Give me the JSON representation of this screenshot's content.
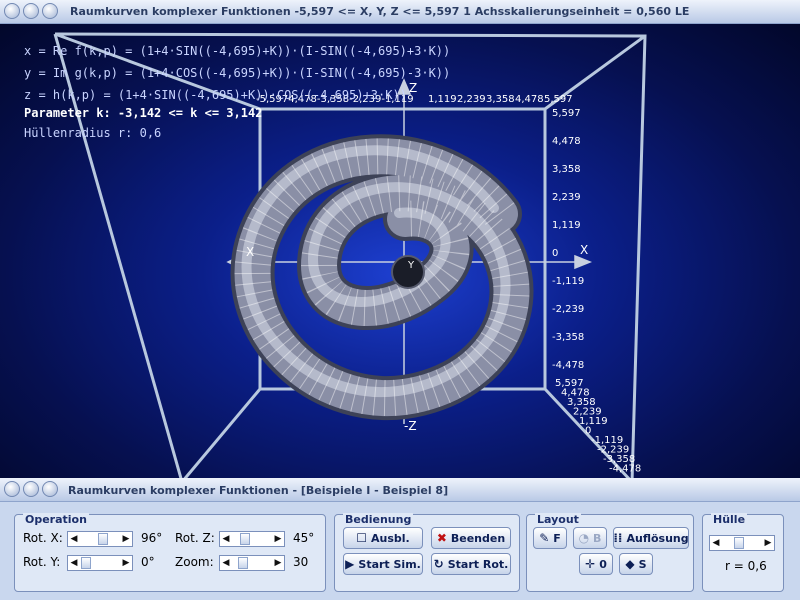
{
  "window_top": {
    "title": "Raumkurven komplexer Funktionen   -5,597 <= X, Y, Z <= 5,597    1 Achsskalierungseinheit = 0,560 LE"
  },
  "window_bottom": {
    "title": "Raumkurven komplexer Funktionen - [Beispiele I - Beispiel 8]"
  },
  "formulas": {
    "x": "x = Re f(k,p) = (1+4·SIN((-4,695)+K))·(I-SIN((-4,695)+3·K))",
    "y": "y = Im g(k,p) = (1+4·COS((-4,695)+K))·(I-SIN((-4,695)-3·K))",
    "z": "z = h(k,p) = (1+4·SIN((-4,695)+K))·COS((-4,695)+3·K))",
    "param": "Parameter k: -3,142 <= k <= 3,142",
    "radius": "Hüllenradius r: 0,6"
  },
  "axes": {
    "x_name": "X",
    "x_neg_name": "X",
    "z_name": "Z",
    "z_neg_name": "-Z",
    "y_name": "Y",
    "top_left_ticks": "-5,5974,478-3,358-2,239-1,119",
    "top_right_ticks": [
      "1,119",
      "2,239",
      "3,358",
      "4,478",
      "5,597"
    ],
    "right_ticks": [
      "5,597",
      "4,478",
      "3,358",
      "2,239",
      "1,119",
      "0",
      "-1,119",
      "-2,239",
      "-3,358",
      "-4,478"
    ],
    "diag_ticks": [
      "5,597",
      "4,478",
      "3,358",
      "2,239",
      "1,119",
      "0",
      "-1,119",
      "-2,239",
      "-3,358",
      "-4,478"
    ]
  },
  "operation": {
    "title": "Operation",
    "rot_x_label": "Rot. X:",
    "rot_x_value": "96°",
    "rot_y_label": "Rot. Y:",
    "rot_y_value": "0°",
    "rot_z_label": "Rot. Z:",
    "rot_z_value": "45°",
    "zoom_label": "Zoom:",
    "zoom_value": "30"
  },
  "bedienung": {
    "title": "Bedienung",
    "ausbl": "Ausbl.",
    "beenden": "Beenden",
    "start_sim": "Start Sim.",
    "start_rot": "Start Rot."
  },
  "layout": {
    "title": "Layout",
    "f": "F",
    "b": "B",
    "aufloesung": "Auflösung",
    "zero": "0",
    "s": "S"
  },
  "huelle": {
    "title": "Hülle",
    "value": "r = 0,6"
  },
  "colors": {
    "background": "#0b1f8a",
    "tube": "#8a8fa6",
    "frame": "#b8c8de"
  }
}
